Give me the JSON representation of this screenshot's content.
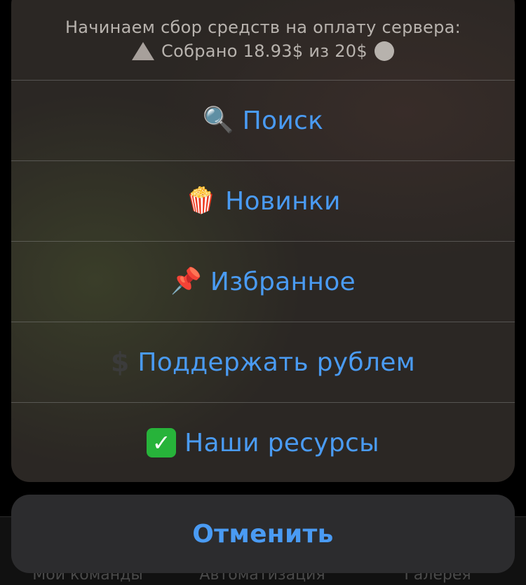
{
  "background_tabbar": {
    "tabs": [
      "Мои команды",
      "Автоматизация",
      "Галерея"
    ]
  },
  "sheet": {
    "header": {
      "line1": "Начинаем сбор средств на оплату сервера:",
      "line2": "Собрано 18.93$ из 20$",
      "left_icon": "warning-triangle-icon",
      "right_icon": "gray-circle-icon"
    },
    "actions": [
      {
        "icon": "🔍",
        "icon_name": "magnifier-icon",
        "label": "Поиск"
      },
      {
        "icon": "🍿",
        "icon_name": "popcorn-icon",
        "label": "Новинки"
      },
      {
        "icon": "📌",
        "icon_name": "pushpin-icon",
        "label": "Избранное"
      },
      {
        "icon": "$",
        "icon_name": "dollar-icon",
        "label": "Поддержать рублем"
      },
      {
        "icon": "✓",
        "icon_name": "checkmark-icon",
        "label": "Наши ресурсы"
      }
    ],
    "accent_color": "#4a9bf3"
  },
  "cancel": {
    "label": "Отменить"
  }
}
